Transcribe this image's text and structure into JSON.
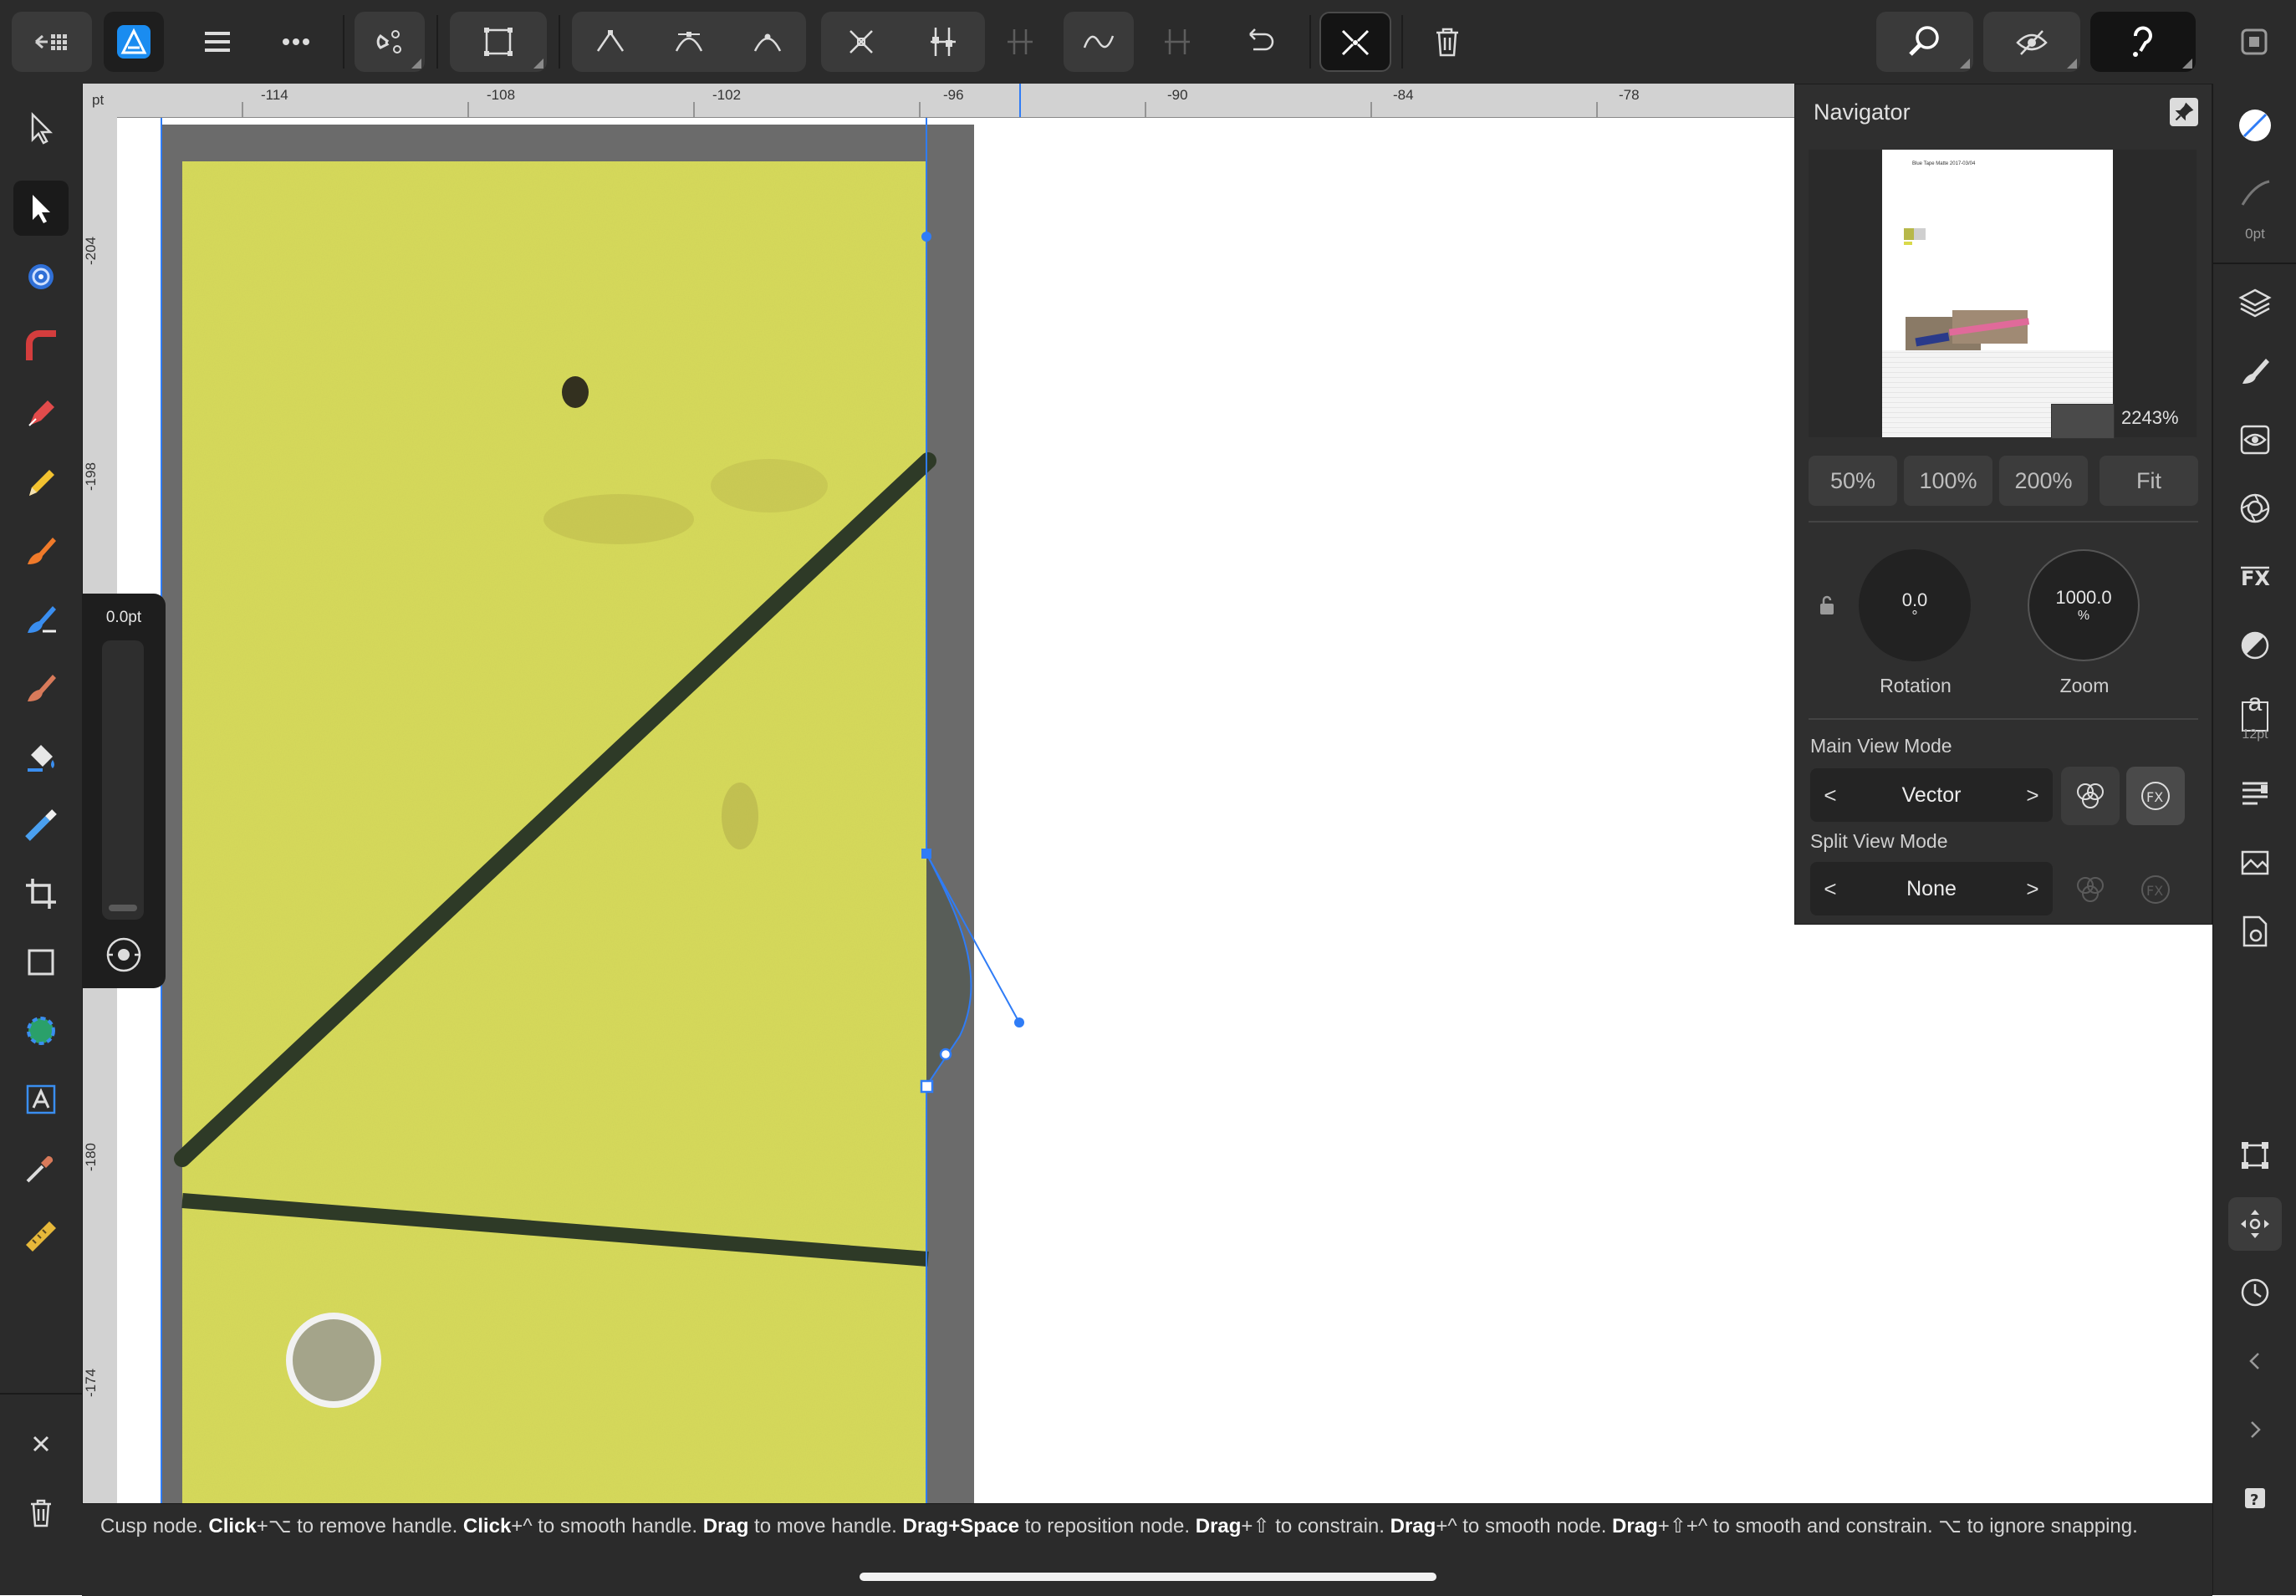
{
  "ruler": {
    "unit": "pt",
    "top_ticks": [
      "-114",
      "-108",
      "-102",
      "-96",
      "-90",
      "-84",
      "-78"
    ],
    "left_ticks": [
      "-204",
      "-198",
      "-180",
      "-174"
    ]
  },
  "toolbar": {
    "icons": [
      "back-grid-icon",
      "affinity-designer-logo-icon",
      "hamburger-menu-icon",
      "more-icon",
      "snapping-magnet-icon",
      "transform-box-icon",
      "sharp-node-icon",
      "smooth-node-icon",
      "smart-node-icon",
      "break-curve-icon",
      "join-curves-icon",
      "align-nodes-icon",
      "convert-curve-icon",
      "distribute-nodes-icon",
      "reverse-curve-icon",
      "transform-mode-icon",
      "delete-icon",
      "zoom-icon",
      "view-icon",
      "help-icon",
      "window-icon"
    ]
  },
  "stroke": {
    "width_label": "0pt"
  },
  "size_slider": {
    "value_label": "0.0pt"
  },
  "navigator": {
    "title": "Navigator",
    "zoom_percent": "2243%",
    "preview_caption": "Blue Tape Matte 2017-03/04",
    "zoom_buttons": [
      "50%",
      "100%",
      "200%",
      "Fit"
    ],
    "rotation": {
      "value": "0.0",
      "unit": "°",
      "label": "Rotation"
    },
    "zoom": {
      "value": "1000.0",
      "unit": "%",
      "label": "Zoom"
    },
    "main_view_mode": {
      "label": "Main View Mode",
      "value": "Vector"
    },
    "split_view_mode": {
      "label": "Split View Mode",
      "value": "None"
    }
  },
  "right_panel": {
    "text_size_label": "12pt",
    "text_glyph": "a"
  },
  "status": {
    "parts": [
      {
        "t": "Cusp node. ",
        "b": false
      },
      {
        "t": "Click",
        "b": true
      },
      {
        "t": "+⌥ to remove handle. ",
        "b": false
      },
      {
        "t": "Click",
        "b": true
      },
      {
        "t": "+^ to smooth handle. ",
        "b": false
      },
      {
        "t": "Drag",
        "b": true
      },
      {
        "t": " to move handle. ",
        "b": false
      },
      {
        "t": "Drag+Space",
        "b": true
      },
      {
        "t": " to reposition node. ",
        "b": false
      },
      {
        "t": "Drag",
        "b": true
      },
      {
        "t": "+⇧ to constrain. ",
        "b": false
      },
      {
        "t": "Drag",
        "b": true
      },
      {
        "t": "+^ to smooth node. ",
        "b": false
      },
      {
        "t": "Drag",
        "b": true
      },
      {
        "t": "+⇧+^ to smooth and constrain. ⌥ to ignore snapping.",
        "b": false
      }
    ]
  },
  "colors": {
    "accent": "#2f7cf6",
    "ui_dark": "#2b2b2b",
    "paper_yellow": "#d9dd5c",
    "ink": "#2d3a26"
  }
}
